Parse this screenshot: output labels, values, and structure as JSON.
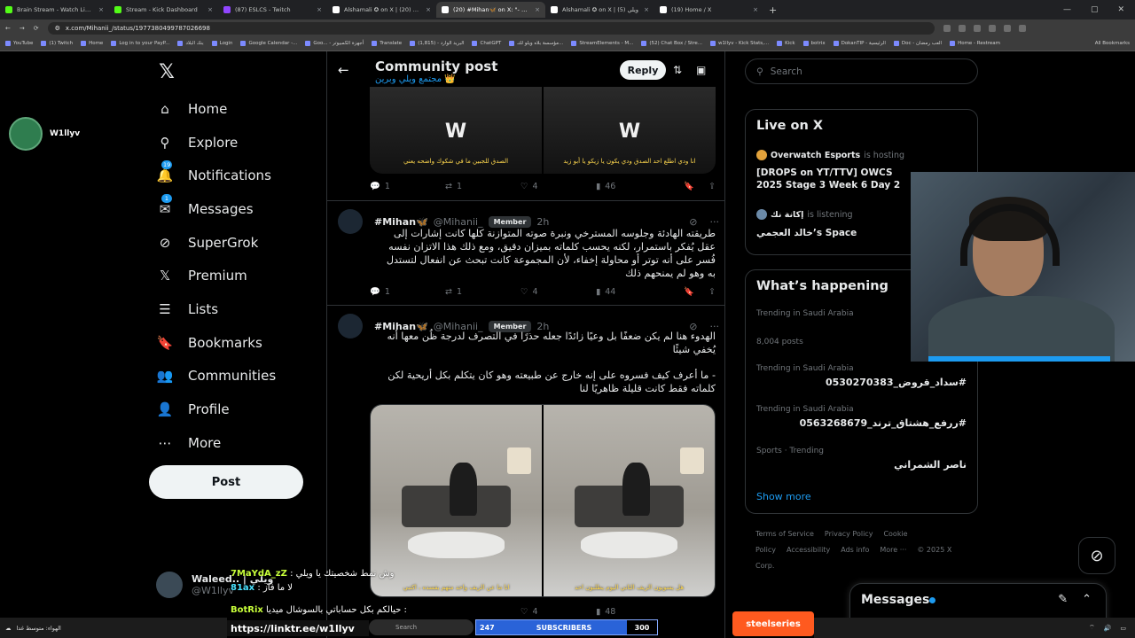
{
  "browser": {
    "tabs": [
      {
        "label": "Brain Stream - Watch Live on K",
        "color": "#53fc18",
        "active": false
      },
      {
        "label": "Stream - Kick Dashboard",
        "color": "#53fc18",
        "active": false
      },
      {
        "label": "(87) ESLCS - Twitch",
        "color": "#9146ff",
        "active": false
      },
      {
        "label": "Alshamali ✪ on X | ويلي (20)",
        "color": "#ffffff",
        "active": false
      },
      {
        "label": "(20) #Mihan🦋 on X: \"- 5# ...\"",
        "color": "#ffffff",
        "active": true
      },
      {
        "label": "Alshamali ✪ on X | ويلي (5)",
        "color": "#ffffff",
        "active": false
      },
      {
        "label": "(19) Home / X",
        "color": "#ffffff",
        "active": false
      }
    ],
    "tab_close": "×",
    "tab_plus": "+",
    "url": "x.com/Mihanii_/status/1977380499787026698",
    "bookmarks": [
      "YouTube",
      "(1) Twitch",
      "Home",
      "Log in to your PayP...",
      "بنك البلاد",
      "Login",
      "Google Calendar -...",
      "Goo... - أجهزة الكمبيوتر",
      "Translate",
      "البريد الوارد - (1,815)",
      "ChatGPT",
      "مؤسسة بلاه ويلو للتـ...",
      "StreamElements - M...",
      "(52) Chat Box / Stre...",
      "w1llyv - Kick Stats,...",
      "Kick",
      "botrix",
      "DokanTIP - الرئيسية",
      "Doc - ‏العب رمضان",
      "Home - Restream"
    ],
    "bookmarks_all": "All Bookmarks"
  },
  "sidebar": {
    "logo": "𝕏",
    "items": [
      {
        "label": "Home",
        "icon": "home-icon",
        "glyph": "⌂",
        "badge": ""
      },
      {
        "label": "Explore",
        "icon": "search-icon",
        "glyph": "⚲",
        "badge": ""
      },
      {
        "label": "Notifications",
        "icon": "bell-icon",
        "glyph": "🔔",
        "badge": "19"
      },
      {
        "label": "Messages",
        "icon": "envelope-icon",
        "glyph": "✉",
        "badge": "1"
      },
      {
        "label": "SuperGrok",
        "icon": "grok-icon",
        "glyph": "⊘",
        "badge": ""
      },
      {
        "label": "Premium",
        "icon": "x-premium-icon",
        "glyph": "𝕏",
        "badge": ""
      },
      {
        "label": "Lists",
        "icon": "list-icon",
        "glyph": "☰",
        "badge": ""
      },
      {
        "label": "Bookmarks",
        "icon": "bookmark-icon",
        "glyph": "🔖",
        "badge": ""
      },
      {
        "label": "Communities",
        "icon": "people-icon",
        "glyph": "👥",
        "badge": ""
      },
      {
        "label": "Profile",
        "icon": "person-icon",
        "glyph": "👤",
        "badge": ""
      },
      {
        "label": "More",
        "icon": "more-circle-icon",
        "glyph": "⋯",
        "badge": ""
      }
    ],
    "post_label": "Post",
    "account": {
      "name": "Waleed.. | ويلي",
      "handle": "@W1llyv"
    }
  },
  "streamer_name": "W1llyv",
  "main": {
    "title": "Community post",
    "subtitle": "مجتمع ويلي وبرين 👑",
    "reply_label": "Reply",
    "first_actions": {
      "replies": "1",
      "reposts": "1",
      "likes": "4",
      "views": "46"
    },
    "media_top_captions": [
      "الصدق للجبين ما في شكوك واضحه يعني",
      "انا ودي اطلع احد الصدق ودي يكون يا زيكو يا أبو زيد"
    ],
    "tweets": [
      {
        "name": "#Mihan🦋",
        "handle": "@Mihanii_",
        "badge": "Member",
        "time": "2h",
        "text": "طريقته الهادئة وجلوسه المسترخي ونبرة صوته المتوازنة كلها كانت إشارات إلى عقل يُفكر باستمرار، لكنه يحسب كلماته بميزان دقيق، ومع ذلك هذا الاتزان نفسه فُسر على أنه توتر أو محاولة إخفاء، لأن المجموعة كانت تبحث عن انفعال لتستدل به وهو لم يمنحهم ذلك",
        "actions": {
          "replies": "1",
          "reposts": "1",
          "likes": "4",
          "views": "44"
        }
      },
      {
        "name": "#Mihan🦋",
        "handle": "@Mihanii_",
        "badge": "Member",
        "time": "2h",
        "text": "الهدوء هنا لم يكن ضعفًا بل وعيًا زائدًا جعله حذرًا في التصرف لدرجة ظُن معها أنه يُخفي شيئًا",
        "text2": "- ما أعرف كيف فسروه على إنه خارج عن طبيعته وهو كان يتكلم بكل أريحية لكن كلماته فقط كانت قليلة ظاهريًا لنا",
        "media_captions": [
          "انا ما عن الزيف واحد متهم بفسده ، اكتبي",
          "هل يسويون الزيف الثاني اليوم يطلبون احد"
        ],
        "actions": {
          "likes": "4",
          "views": "48"
        }
      }
    ]
  },
  "right": {
    "search_placeholder": "Search",
    "live": {
      "title": "Live on X",
      "items": [
        {
          "host": "Overwatch Esports",
          "verb": "is hosting",
          "title": "[DROPS on YT/TTV] OWCS 2025 Stage 3 Week 6 Day 2"
        },
        {
          "host": "إكانة نك",
          "verb": "is listening",
          "title": "خالد العجمي’s Space"
        }
      ]
    },
    "happening": {
      "title": "What’s happening",
      "trends": [
        {
          "category": "Trending in Saudi Arabia",
          "name": "",
          "count": "8,004 posts"
        },
        {
          "category": "Trending in Saudi Arabia",
          "name": "#سداد_قروض_0530270383",
          "count": ""
        },
        {
          "category": "Trending in Saudi Arabia",
          "name": "#ررفع_هشتاق_ترند_0563268679",
          "count": ""
        },
        {
          "category": "Sports · Trending",
          "name": "ناصر الشمراني",
          "count": ""
        }
      ],
      "show_more": "Show more"
    },
    "footer": [
      "Terms of Service",
      "Privacy Policy",
      "Cookie Policy",
      "Accessibility",
      "Ads info",
      "More ···",
      "© 2025 X Corp."
    ],
    "messages_label": "Messages"
  },
  "overlay": {
    "chat": [
      {
        "user": "7MaYdA_zZ",
        "text": "وش نمط شخصيتك يا ويلي :"
      },
      {
        "user": "81ax",
        "text": "لا ما فاز :"
      }
    ],
    "botrix_user": "BotRix",
    "botrix_text": "حيالكم بكل حساباتي بالسوشال ميديا :",
    "linktree": "https://linktr.ee/w1llyv",
    "subs_left": "247",
    "subs_label": "SUBSCRIBERS",
    "subs_right": "300",
    "sponsor": "steelseries",
    "weather": "الهواء: متوسط غدا",
    "taskbar_search": "Search"
  }
}
